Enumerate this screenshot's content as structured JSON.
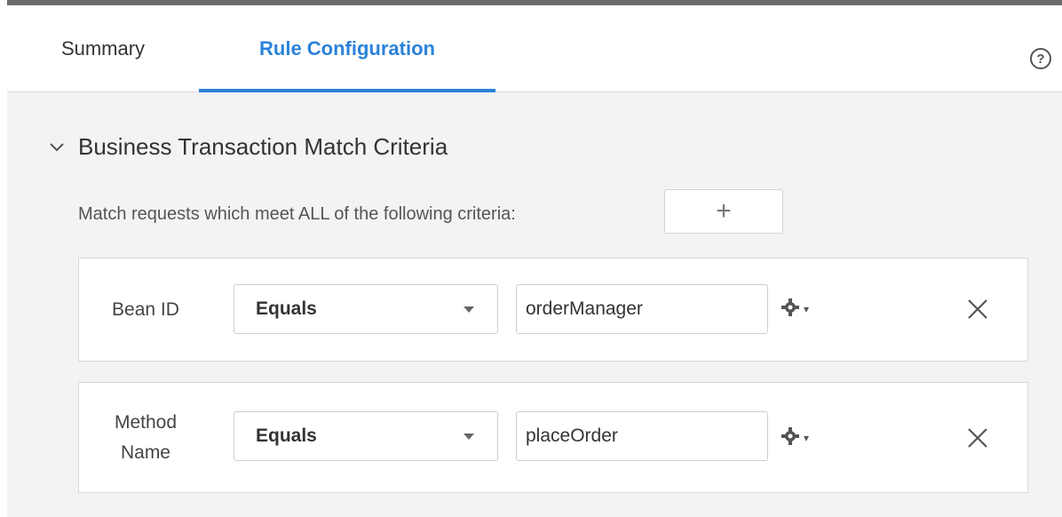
{
  "tabs": [
    {
      "label": "Summary",
      "active": false
    },
    {
      "label": "Rule Configuration",
      "active": true
    }
  ],
  "help": {
    "icon": "help-icon",
    "glyph": "?"
  },
  "section": {
    "title": "Business Transaction Match Criteria",
    "expanded": true,
    "criteria_text": "Match requests which meet ALL of the following criteria:",
    "add_label": "+"
  },
  "rows": [
    {
      "label": "Bean ID",
      "operator": "Equals",
      "value": "orderManager"
    },
    {
      "label": "Method\nName",
      "operator": "Equals",
      "value": "placeOrder"
    }
  ],
  "colors": {
    "accent": "#2b82d9",
    "background": "#f3f3f3",
    "panel": "#ffffff",
    "border": "#d9d9d9"
  }
}
